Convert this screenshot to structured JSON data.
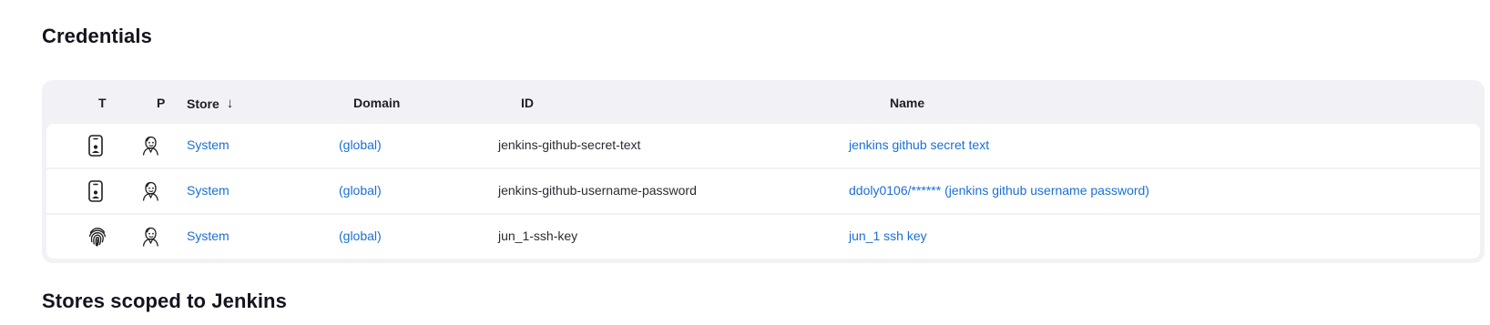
{
  "sections": {
    "credentials_title": "Credentials",
    "stores_title": "Stores scoped to Jenkins"
  },
  "table": {
    "headers": {
      "t": "T",
      "p": "P",
      "store": "Store",
      "store_sort": "↓",
      "domain": "Domain",
      "id": "ID",
      "name": "Name"
    },
    "rows": [
      {
        "type_icon": "phone-icon",
        "provider_icon": "jenkins-icon",
        "store": "System",
        "domain": "(global)",
        "id": "jenkins-github-secret-text",
        "name": "jenkins github secret text"
      },
      {
        "type_icon": "phone-icon",
        "provider_icon": "jenkins-icon",
        "store": "System",
        "domain": "(global)",
        "id": "jenkins-github-username-password",
        "name": "ddoly0106/****** (jenkins github username password)"
      },
      {
        "type_icon": "fingerprint-icon",
        "provider_icon": "jenkins-icon",
        "store": "System",
        "domain": "(global)",
        "id": "jun_1-ssh-key",
        "name": "jun_1 ssh key"
      }
    ]
  },
  "colors": {
    "link": "#1a6fd6",
    "table_bg": "#f2f2f6",
    "row_bg": "#ffffff"
  }
}
